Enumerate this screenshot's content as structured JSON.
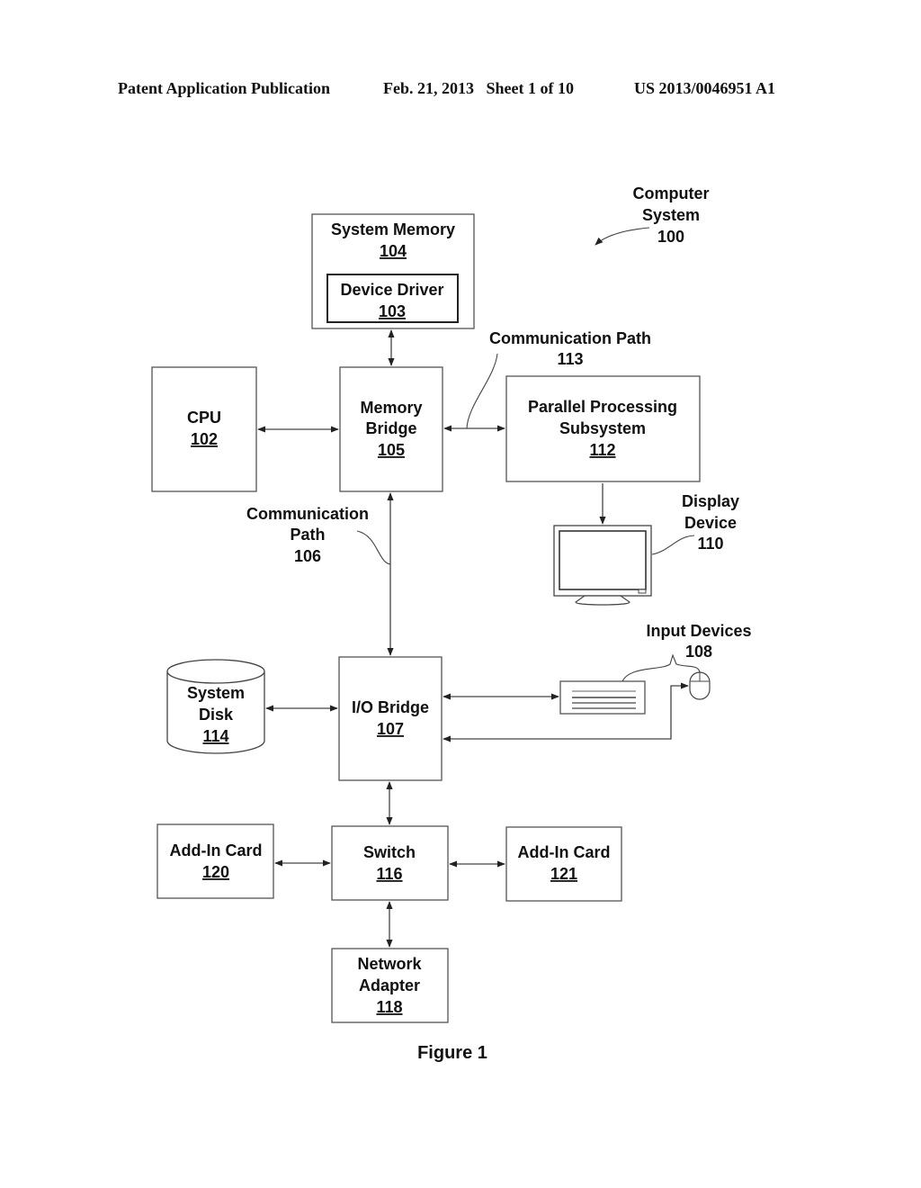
{
  "header": {
    "publication": "Patent Application Publication",
    "date_sheet": "Feb. 21, 2013   Sheet 1 of 10",
    "number": "US 2013/0046951 A1"
  },
  "system_label": {
    "line1": "Computer",
    "line2": "System",
    "ref": "100"
  },
  "blocks": {
    "system_memory": {
      "line1": "System Memory",
      "ref": "104"
    },
    "device_driver": {
      "line1": "Device Driver",
      "ref": "103"
    },
    "cpu": {
      "line1": "CPU",
      "ref": "102"
    },
    "memory_bridge": {
      "line1": "Memory",
      "line2": "Bridge",
      "ref": "105"
    },
    "parallel_processing": {
      "line1": "Parallel Processing",
      "line2": "Subsystem",
      "ref": "112"
    },
    "io_bridge": {
      "line1": "I/O Bridge",
      "ref": "107"
    },
    "system_disk": {
      "line1": "System",
      "line2": "Disk",
      "ref": "114"
    },
    "switch": {
      "line1": "Switch",
      "ref": "116"
    },
    "add_in_card_120": {
      "line1": "Add-In Card",
      "ref": "120"
    },
    "add_in_card_121": {
      "line1": "Add-In Card",
      "ref": "121"
    },
    "network_adapter": {
      "line1": "Network",
      "line2": "Adapter",
      "ref": "118"
    }
  },
  "annotations": {
    "comm_path_113": {
      "line1": "Communication Path",
      "ref": "113"
    },
    "comm_path_106": {
      "line1": "Communication",
      "line2": "Path",
      "ref": "106"
    },
    "display_device": {
      "line1": "Display",
      "line2": "Device",
      "ref": "110"
    },
    "input_devices": {
      "line1": "Input Devices",
      "ref": "108"
    }
  },
  "figure_caption": "Figure 1"
}
